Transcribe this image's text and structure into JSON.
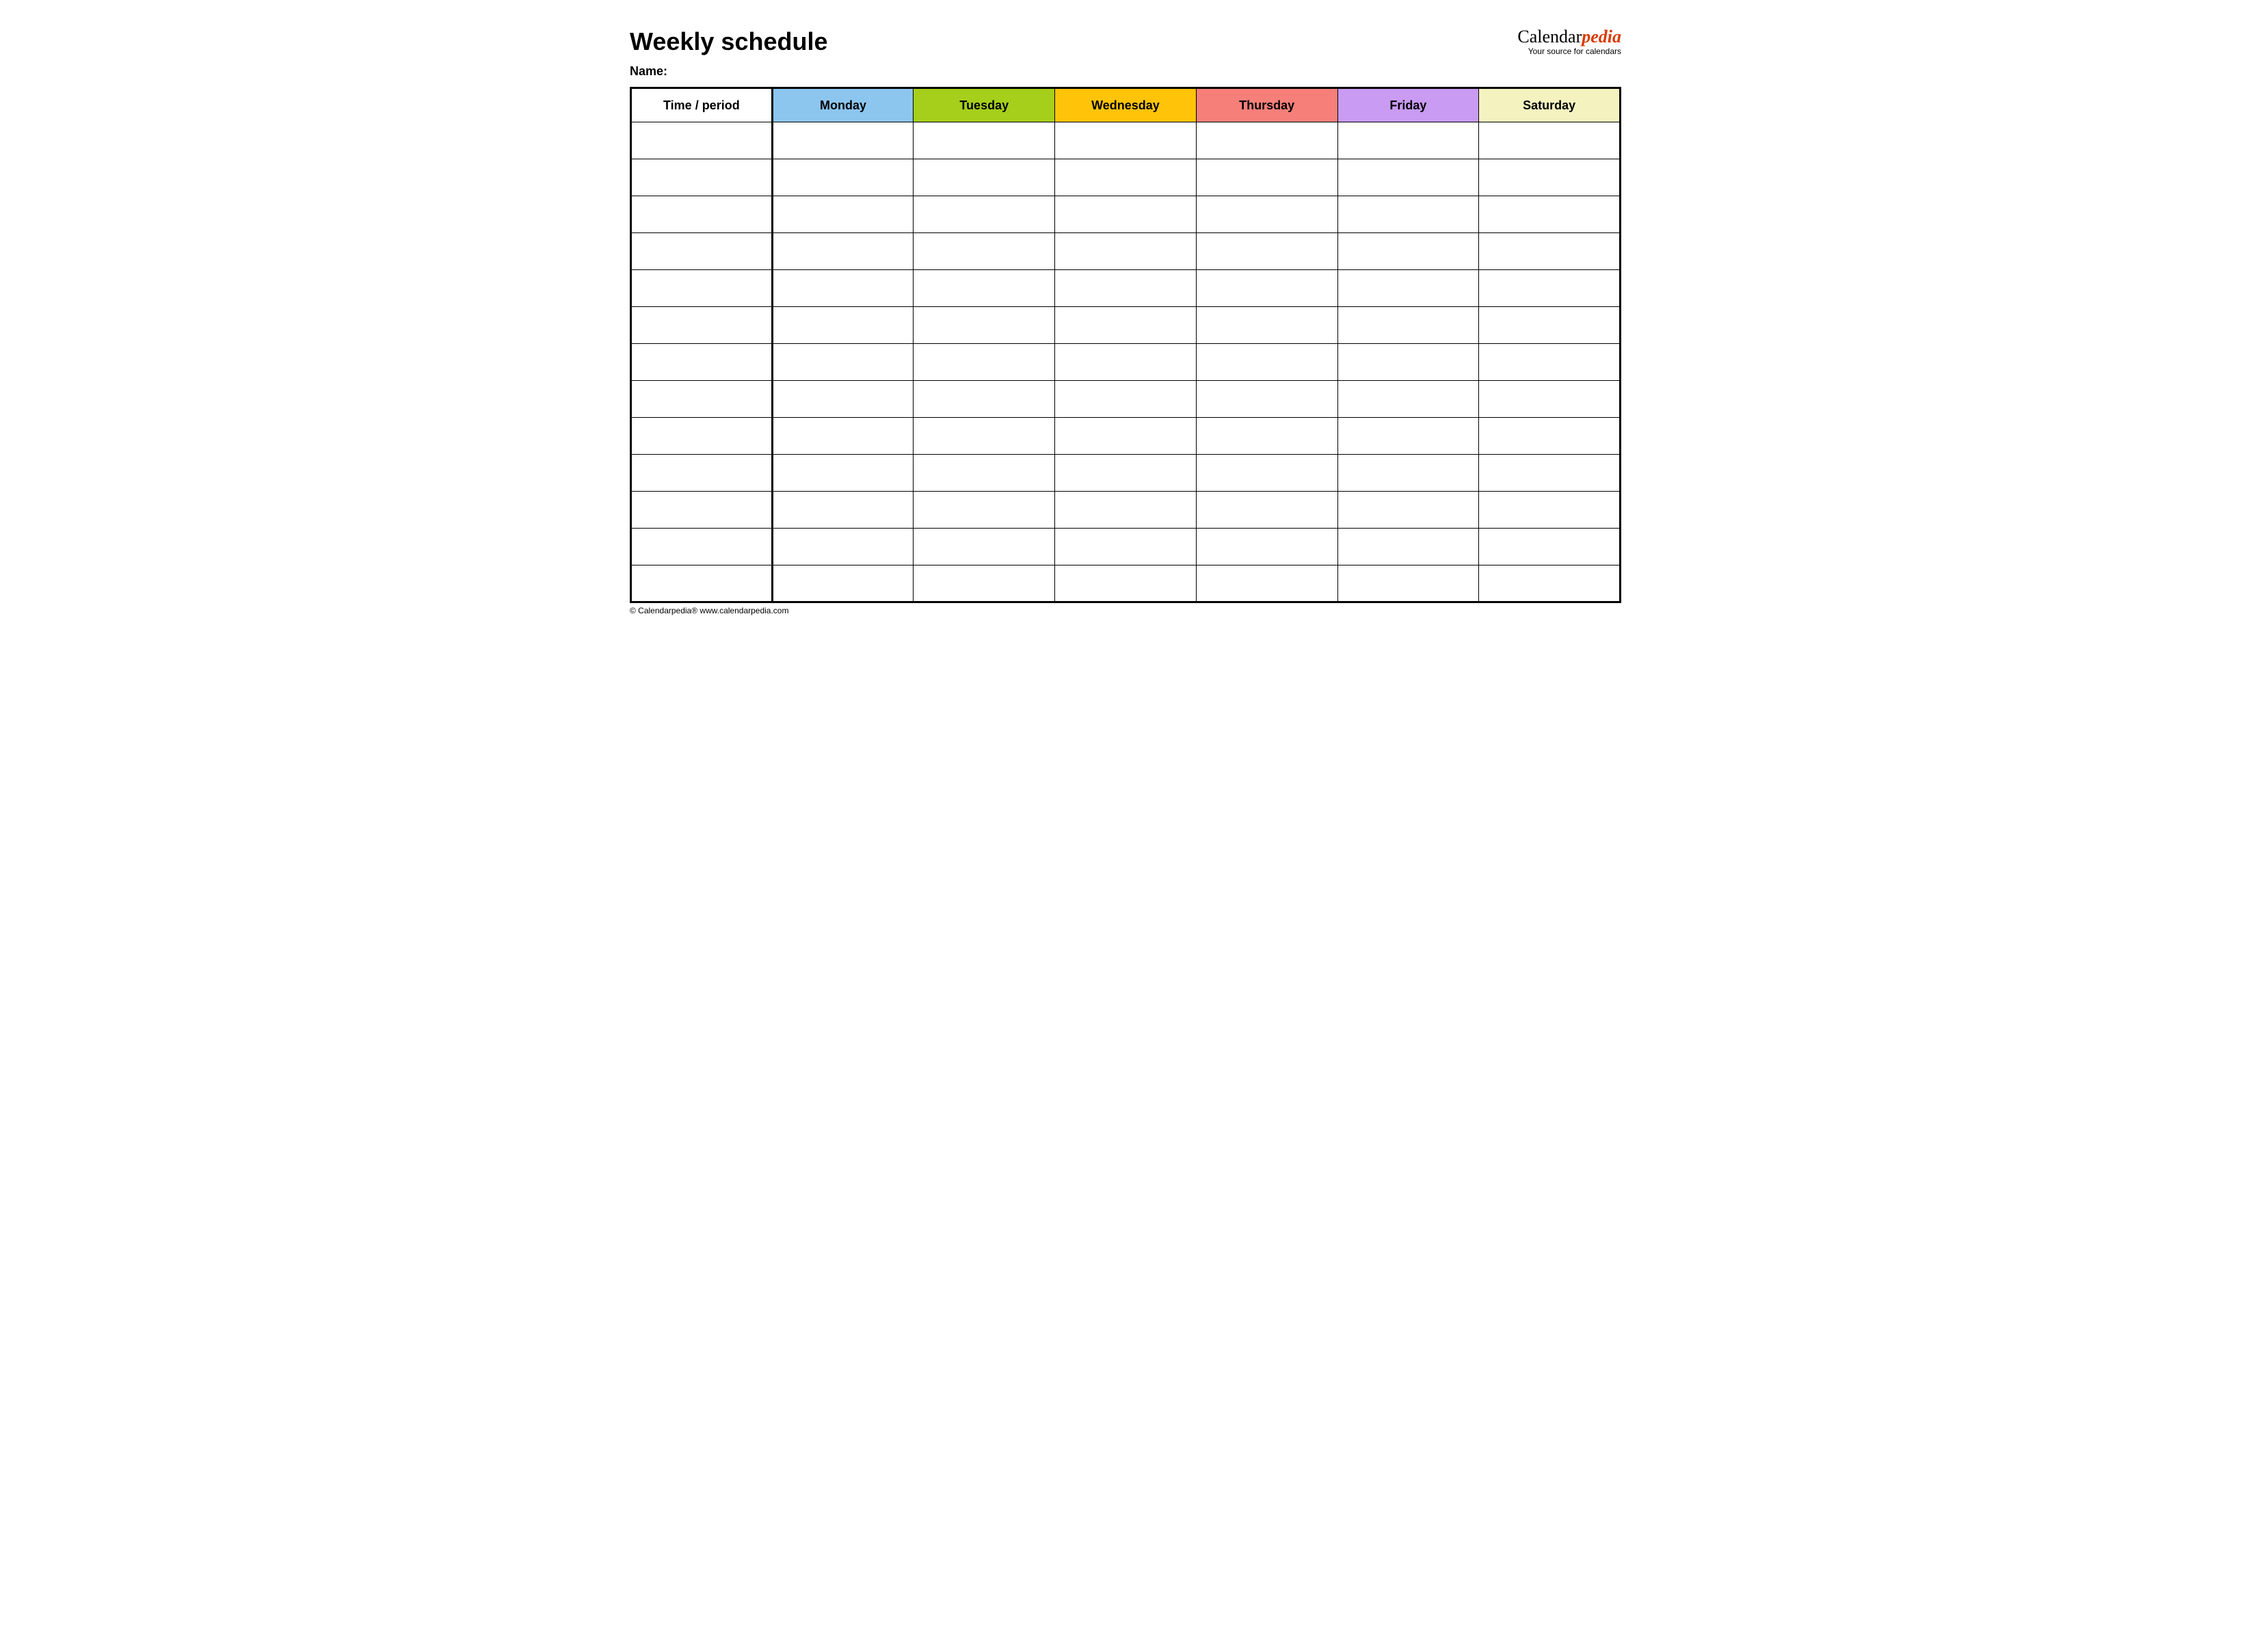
{
  "header": {
    "title": "Weekly schedule",
    "name_label": "Name:",
    "logo_prefix": "Calendar",
    "logo_suffix": "pedia",
    "logo_tagline": "Your source for calendars"
  },
  "table": {
    "time_header": "Time / period",
    "days": [
      {
        "label": "Monday",
        "color": "#8cc6ef"
      },
      {
        "label": "Tuesday",
        "color": "#a5cf1b"
      },
      {
        "label": "Wednesday",
        "color": "#ffc409"
      },
      {
        "label": "Thursday",
        "color": "#f77f7a"
      },
      {
        "label": "Friday",
        "color": "#c99bf3"
      },
      {
        "label": "Saturday",
        "color": "#f4f3c0"
      }
    ],
    "row_count": 13
  },
  "footer": {
    "copyright": "© Calendarpedia®   www.calendarpedia.com"
  }
}
